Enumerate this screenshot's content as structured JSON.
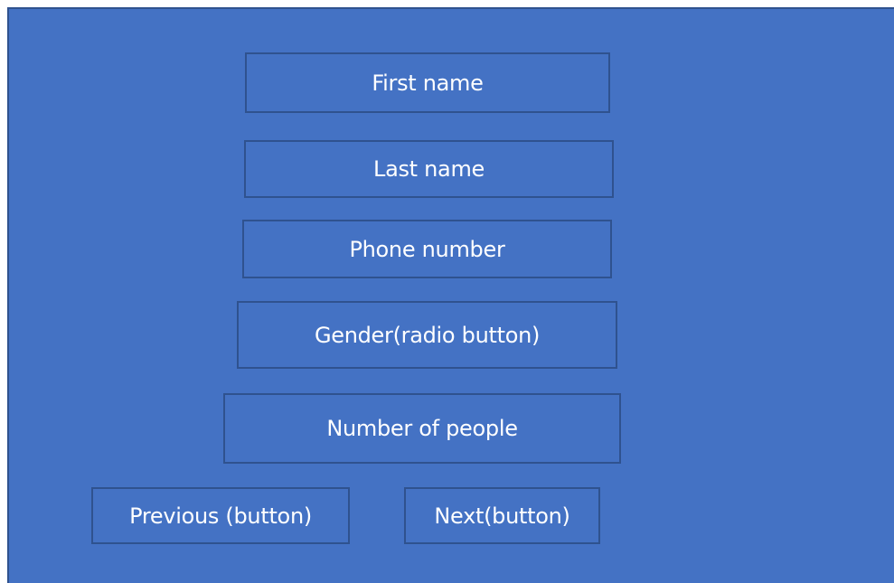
{
  "form": {
    "first_name": "First name",
    "last_name": "Last name",
    "phone_number": "Phone number",
    "gender": "Gender(radio button)",
    "number_of_people": "Number of people"
  },
  "buttons": {
    "previous": "Previous (button)",
    "next": "Next(button)"
  },
  "colors": {
    "background": "#4472c4",
    "border": "#2f528f",
    "text": "#ffffff"
  }
}
